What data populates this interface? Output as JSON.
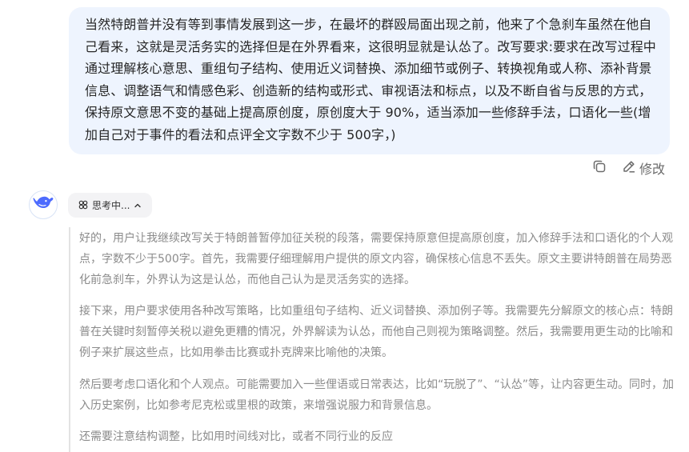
{
  "user_message": {
    "text": "当然特朗普并没有等到事情发展到这一步，在最坏的群殴局面出现之前，他来了个急刹车虽然在他自己看来，这就是灵活务实的选择但是在外界看来，这很明显就是认怂了。改写要求:要求在改写过程中通过理解核心意思、重组句子结构、使用近义词替换、添加细节或例子、转换视角或人称、添补背景信息、调整语气和情感色彩、创造新的结构或形式、审视语法和标点，以及不断自省与反思的方式，保持原文意思不变的基础上提高原创度，原创度大于 90%，适当添加一些修辞手法，口语化一些(增加自己对于事件的看法和点评全文字数不少于 500字，)"
  },
  "actions": {
    "copy_icon": "copy-icon",
    "edit_icon": "pencil-icon",
    "edit_label": "修改"
  },
  "assistant": {
    "avatar_icon": "whale-logo",
    "think_toggle": {
      "label": "思考中...",
      "icon": "thinking-icon",
      "chevron": "chevron-up-icon"
    },
    "thinking_paragraphs": [
      "好的，用户让我继续改写关于特朗普暂停加征关税的段落，需要保持原意但提高原创度，加入修辞手法和口语化的个人观点，字数不少于500字。首先，我需要仔细理解用户提供的原文内容，确保核心信息不丢失。原文主要讲特朗普在局势恶化前急刹车，外界认为这是认怂，而他自己认为是灵活务实的选择。",
      "接下来，用户要求使用各种改写策略，比如重组句子结构、近义词替换、添加例子等。我需要先分解原文的核心点：特朗普在关键时刻暂停关税以避免更糟的情况，外界解读为认怂，而他自己则视为策略调整。然后，我需要用更生动的比喻和例子来扩展这些点，比如用拳击比赛或扑克牌来比喻他的决策。",
      "然后要考虑口语化和个人观点。可能需要加入一些俚语或日常表达，比如“玩脱了”、“认怂”等，让内容更生动。同时，加入历史案例，比如参考尼克松或里根的政策，来增强说服力和背景信息。",
      "还需要注意结构调整，比如用时间线对比，或者不同行业的反应"
    ]
  },
  "colors": {
    "bubble_bg": "#eef4fe",
    "brand_blue": "#4d6bfe",
    "thinking_text": "#8b8b8b"
  }
}
